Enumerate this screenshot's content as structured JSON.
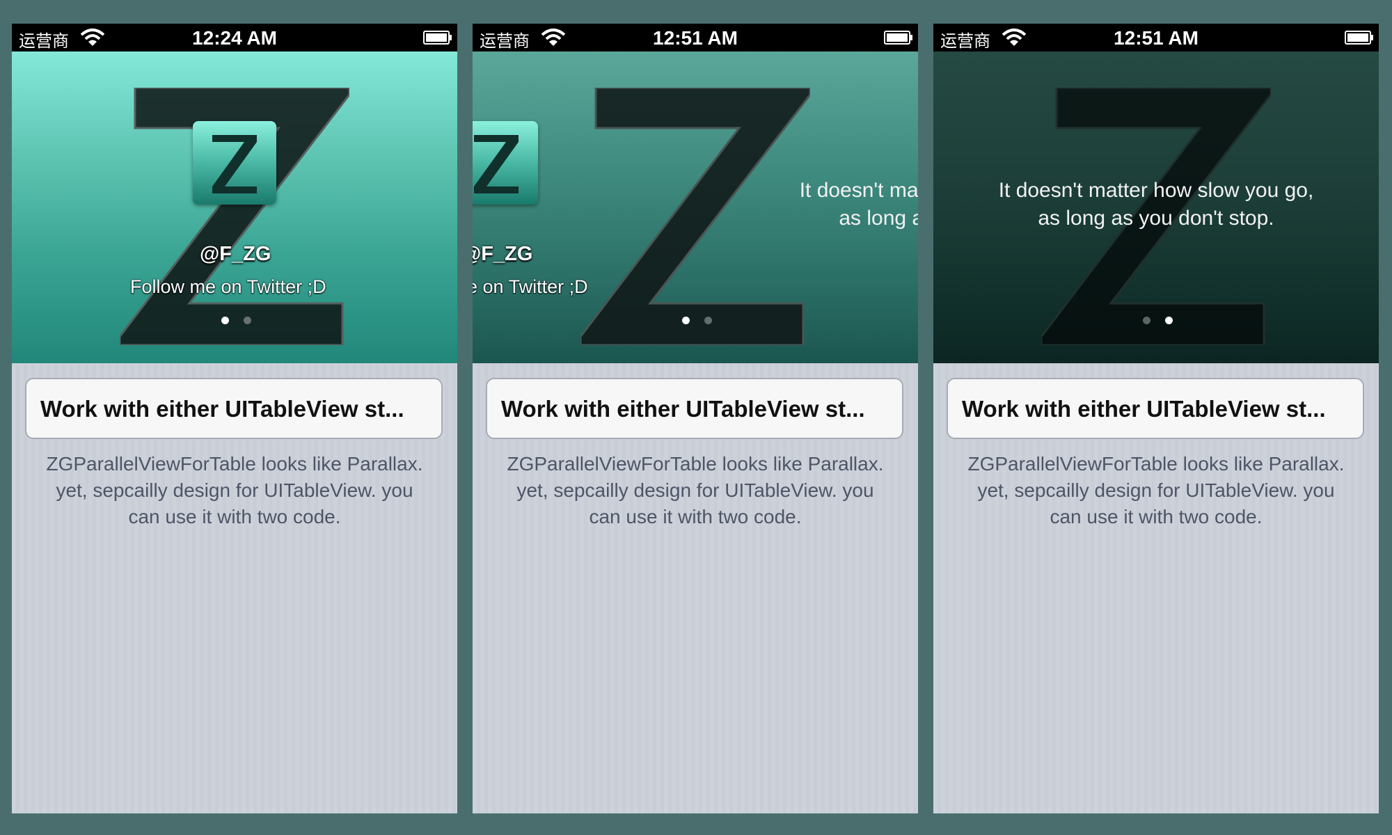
{
  "status_bar": {
    "carrier": "运营商",
    "screens": [
      {
        "time": "12:24 AM"
      },
      {
        "time": "12:51 AM"
      },
      {
        "time": "12:51 AM"
      }
    ]
  },
  "header": {
    "avatar_letter": "Z",
    "handle": "@F_ZG",
    "follow_text": "Follow me on Twitter ;D",
    "quote_line1": "It doesn't matter how slow you go,",
    "quote_line2": "as long as you don't stop.",
    "pages": 2,
    "current_page": [
      1,
      1,
      2
    ]
  },
  "cell": {
    "title": "Work with either UITableView st..."
  },
  "description": "ZGParallelViewForTable looks like Parallax. yet, sepcailly design for UITableView. you can use it with two code.",
  "colors": {
    "background": "#4a6e6e",
    "header_light": "#84e8d8",
    "header_dark": "#0c2622",
    "description_text": "#4d5566"
  },
  "icons": [
    "wifi-icon",
    "battery-icon",
    "z-logo-icon",
    "avatar-icon"
  ]
}
